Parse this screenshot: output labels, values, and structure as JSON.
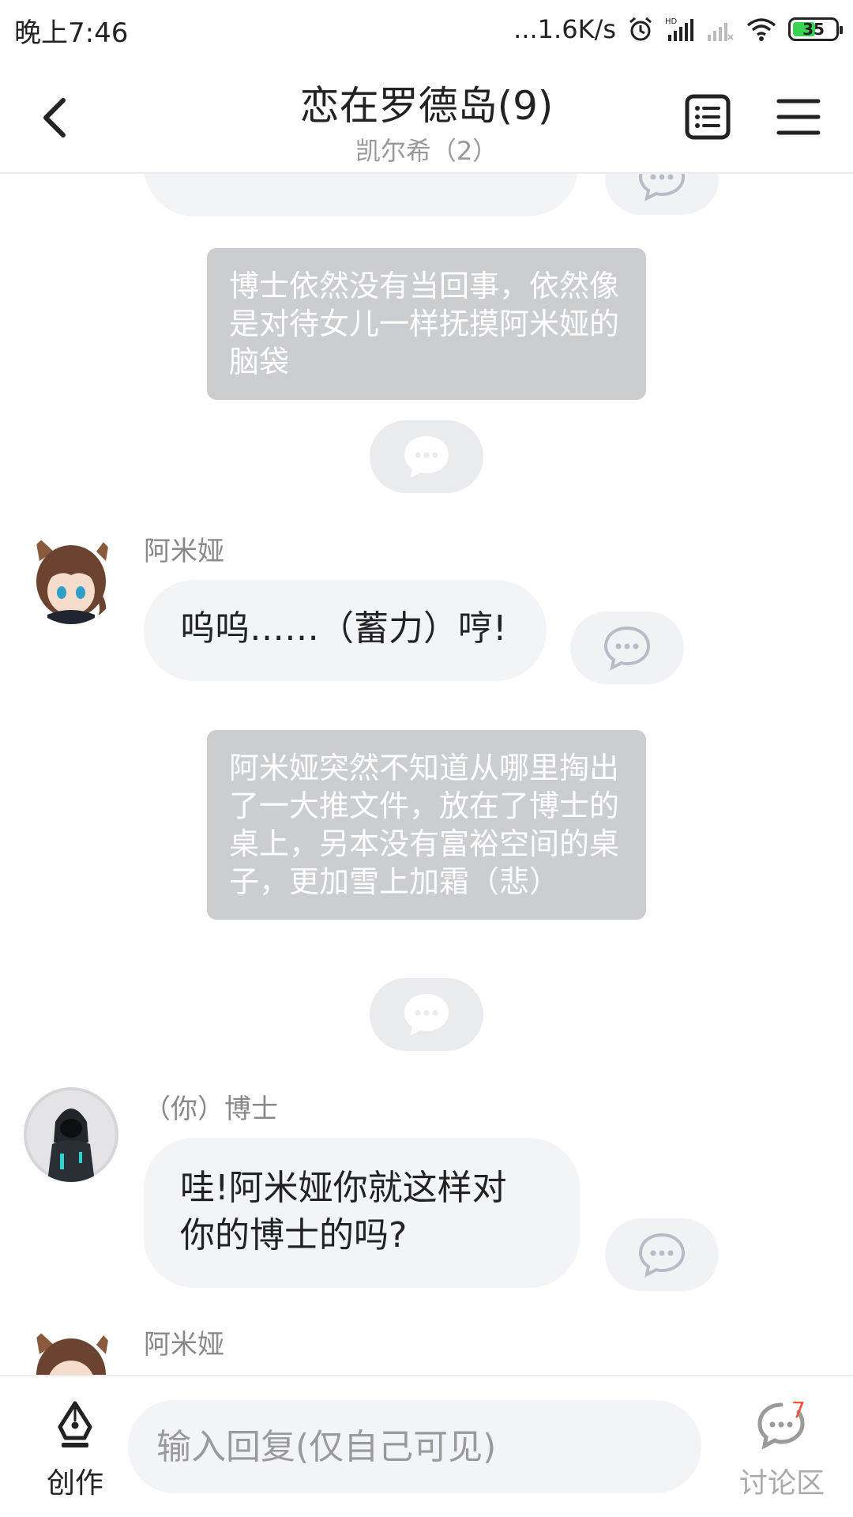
{
  "status_bar": {
    "time": "晚上7:46",
    "network_speed": "...1.6K/s",
    "battery": "35",
    "icons": [
      "alarm-icon",
      "hd-signal-icon",
      "signal-icon",
      "wifi-icon",
      "battery-icon"
    ]
  },
  "header": {
    "title": "恋在罗德岛(9)",
    "subtitle": "凯尔希（2）",
    "icons": [
      "back-icon",
      "outline-icon",
      "menu-icon"
    ]
  },
  "chat": {
    "narration_1": "博士依然没有当回事，依然像是对待女儿一样抚摸阿米娅的脑袋",
    "message_1": {
      "name": "阿米娅",
      "text": "呜呜……（蓄力）哼!"
    },
    "narration_2": "阿米娅突然不知道从哪里掏出了一大推文件，放在了博士的桌上，另本没有富裕空间的桌子，更加雪上加霜（悲）",
    "message_2": {
      "name": "（你）博士",
      "text": "哇!阿米娅你就这样对你的博士的吗?"
    },
    "message_3": {
      "name": "阿米娅"
    }
  },
  "bottom_bar": {
    "create_label": "创作",
    "reply_placeholder": "输入回复(仅自己可见)",
    "discuss_label": "讨论区",
    "discuss_badge": "7"
  },
  "colors": {
    "bubble": "#f3f4f7",
    "narration": "#cccdd1",
    "comment_pill": "#eaebef",
    "badge": "#f0533a",
    "battery_fill": "#39d353"
  }
}
